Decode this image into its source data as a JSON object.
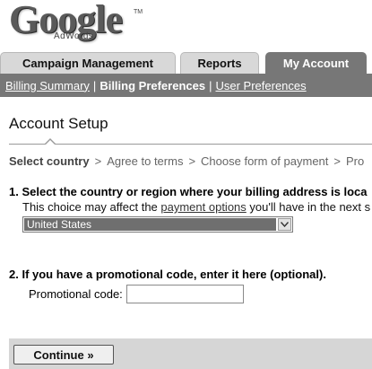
{
  "brand": {
    "logo_text": "Google",
    "logo_tm": "TM",
    "logo_sub": "AdWords"
  },
  "tabs": [
    {
      "label": "Campaign Management"
    },
    {
      "label": "Reports"
    },
    {
      "label": "My Account"
    }
  ],
  "subnav": {
    "items": [
      {
        "label": "Billing Summary"
      },
      {
        "label": "Billing Preferences"
      },
      {
        "label": "User Preferences"
      }
    ],
    "separator": "|"
  },
  "page_title": "Account Setup",
  "steps": [
    {
      "label": "Select country"
    },
    {
      "label": "Agree to terms"
    },
    {
      "label": "Choose form of payment"
    },
    {
      "label": "Pro"
    }
  ],
  "step_arrow": ">",
  "question1": {
    "heading": "1. Select the country or region where your billing address is loca",
    "sub_prefix": "This choice may affect the ",
    "sub_link": "payment options",
    "sub_suffix": " you'll have in the next s",
    "selected_country": "United States"
  },
  "question2": {
    "heading": "2. If you have a promotional code, enter it here (optional).",
    "label": "Promotional code:",
    "value": ""
  },
  "continue_label": "Continue »"
}
